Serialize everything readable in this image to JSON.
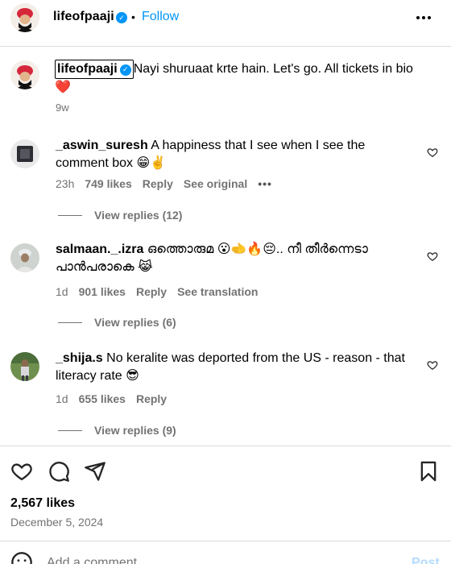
{
  "header": {
    "username": "lifeofpaaji",
    "separator": "•",
    "follow_label": "Follow"
  },
  "caption": {
    "username": "lifeofpaaji",
    "text": "Nayi shuruaat krte hain. Let's go. All tickets in bio",
    "emoji": "❤️",
    "age": "9w"
  },
  "comments": [
    {
      "username": "_aswin_suresh",
      "text": "A happiness that I see when I see the comment box 😁✌️",
      "age": "23h",
      "likes": "749 likes",
      "reply": "Reply",
      "secondary": "See original",
      "more": "•••",
      "view_replies": "View replies (12)"
    },
    {
      "username": "salmaan._.izra",
      "text": "ഒത്തൊരുമ 😮🫲🔥😔.. നീ തീർന്നെടാ പാൻപരാകെ 😹",
      "age": "1d",
      "likes": "901 likes",
      "reply": "Reply",
      "secondary": "See translation",
      "view_replies": "View replies (6)"
    },
    {
      "username": "_shija.s",
      "text": "No keralite was deported from the US - reason - that literacy rate 😎",
      "age": "1d",
      "likes": "655 likes",
      "reply": "Reply",
      "view_replies": "View replies (9)"
    }
  ],
  "footer": {
    "likes": "2,567 likes",
    "date": "December 5, 2024",
    "add_comment_placeholder": "Add a comment...",
    "post_label": "Post"
  },
  "colors": {
    "accent": "#0095f6",
    "muted": "#737373",
    "divider": "#dbdbdb",
    "turban": "#d6283b"
  }
}
